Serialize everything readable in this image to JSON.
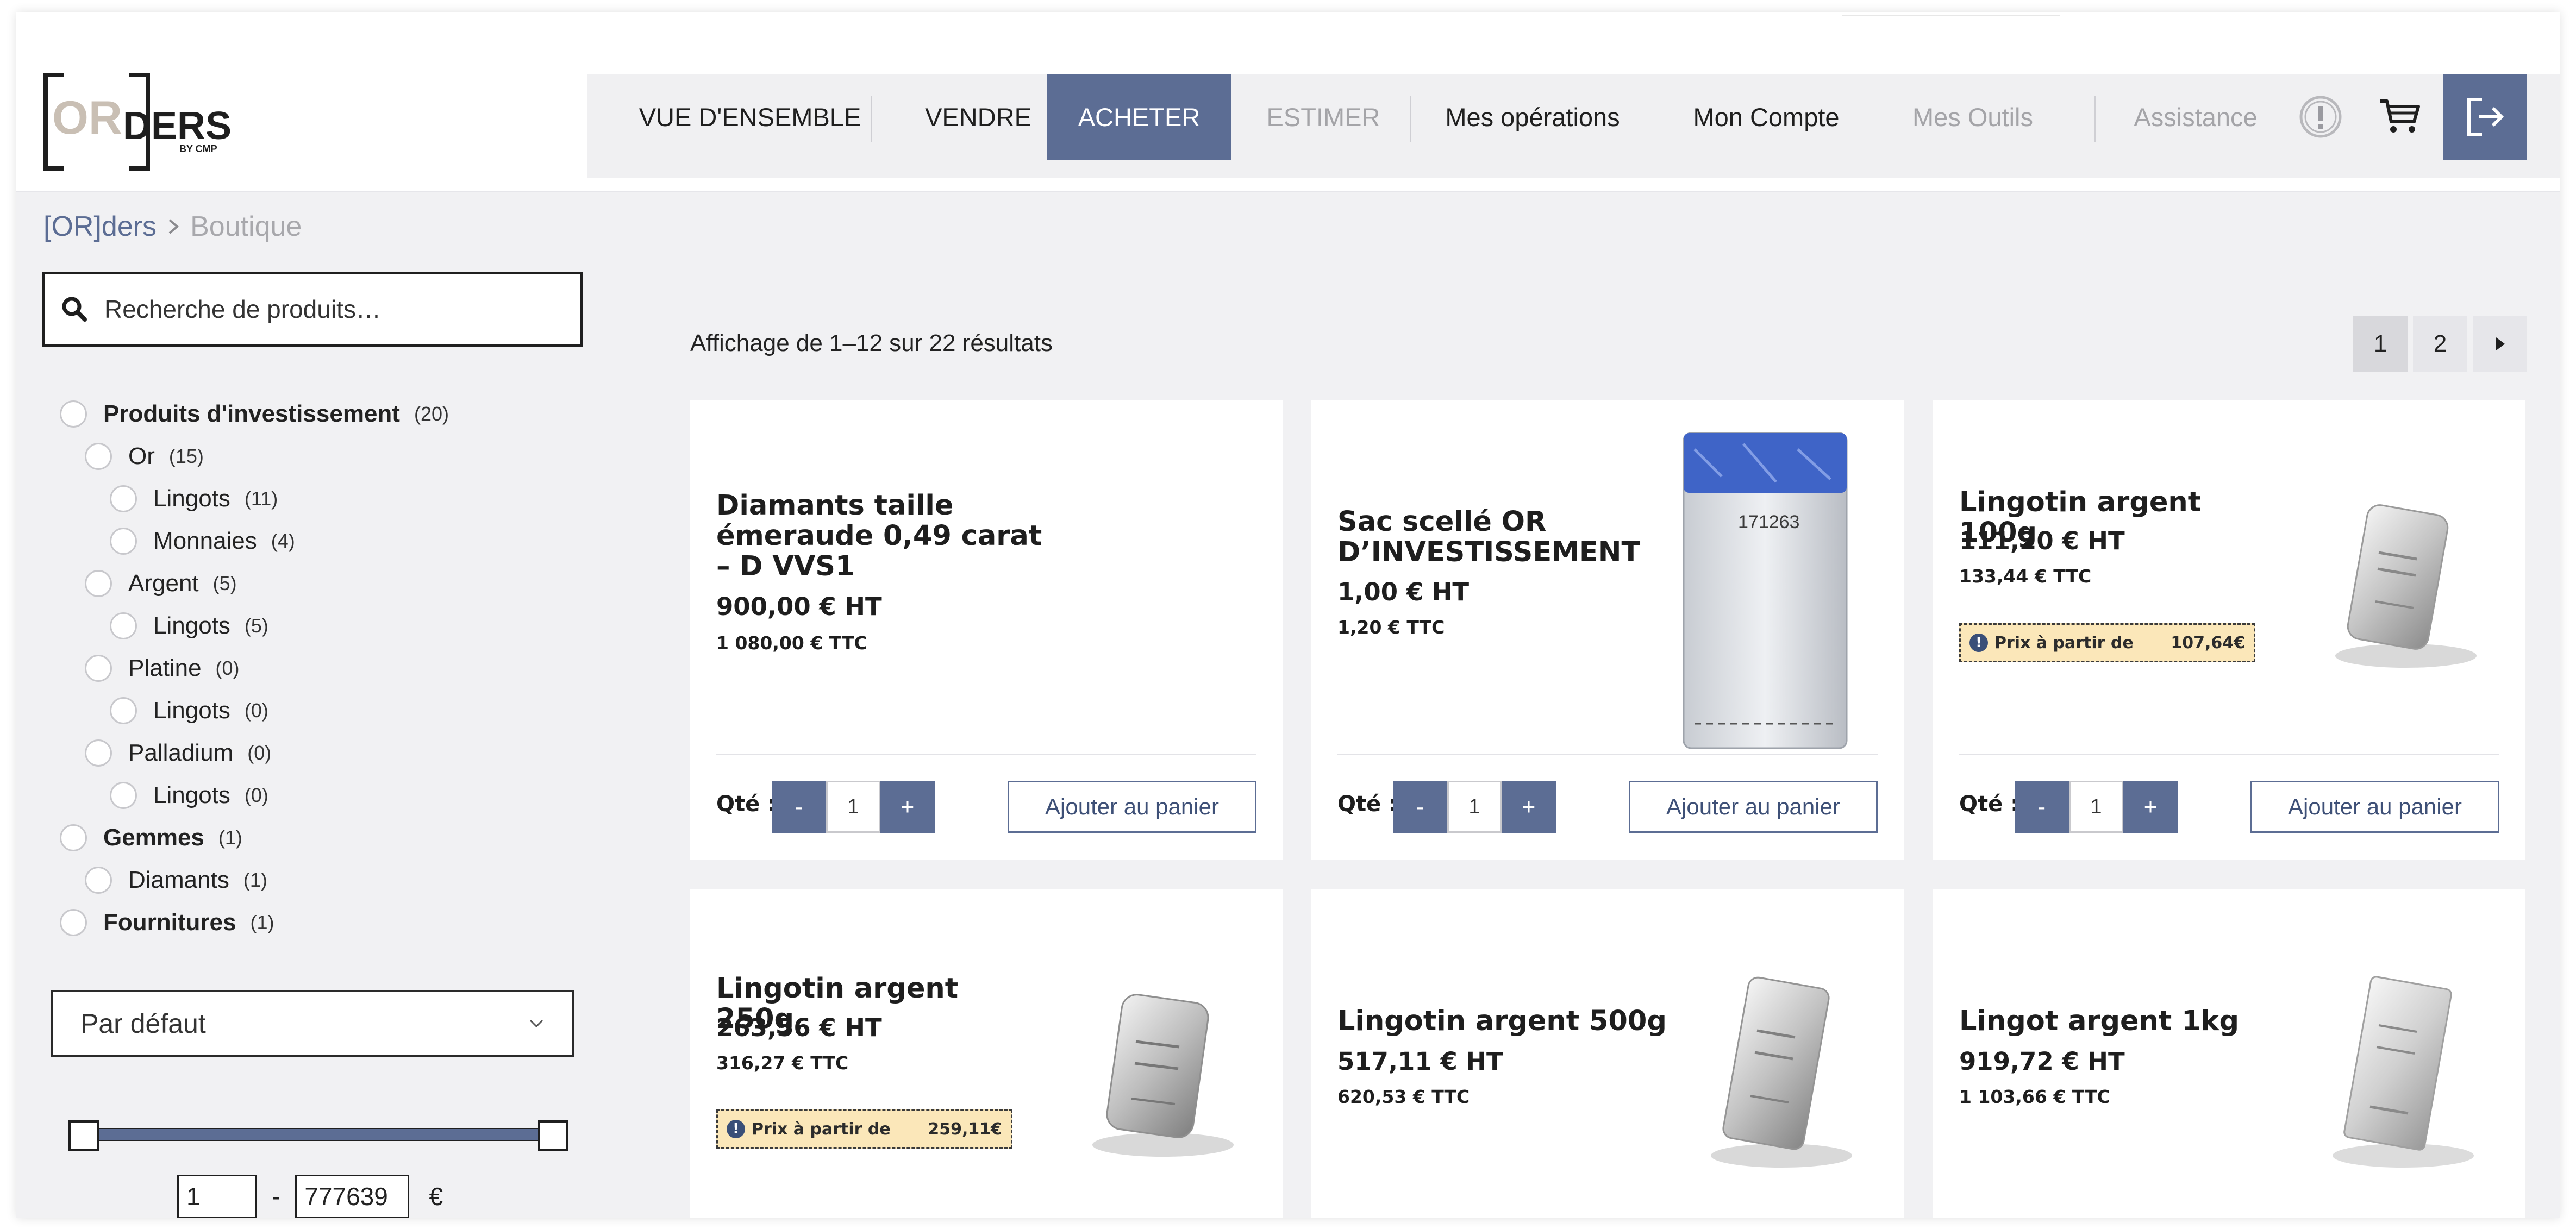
{
  "brand": {
    "logo_text_or": "OR",
    "logo_text_ders": "DERS",
    "logo_subtext": "BY CMP"
  },
  "nav": {
    "items": [
      {
        "label": "VUE D'ENSEMBLE",
        "state": "normal"
      },
      {
        "label": "VENDRE",
        "state": "normal"
      },
      {
        "label": "ACHETER",
        "state": "active"
      },
      {
        "label": "ESTIMER",
        "state": "disabled"
      },
      {
        "label": "Mes opérations",
        "state": "normal"
      },
      {
        "label": "Mon Compte",
        "state": "normal"
      },
      {
        "label": "Mes Outils",
        "state": "disabled"
      },
      {
        "label": "Assistance",
        "state": "disabled"
      }
    ],
    "icons": [
      "alert-circle-icon",
      "cart-icon",
      "logout-icon"
    ]
  },
  "breadcrumb": {
    "home": "[OR]ders",
    "current": "Boutique"
  },
  "search": {
    "placeholder": "Recherche de produits…"
  },
  "categories": [
    {
      "name": "Produits d'investissement",
      "count": "(20)"
    },
    {
      "name": "Or",
      "count": "(15)"
    },
    {
      "name": "Lingots",
      "count": "(11)"
    },
    {
      "name": "Monnaies",
      "count": "(4)"
    },
    {
      "name": "Argent",
      "count": "(5)"
    },
    {
      "name": "Lingots",
      "count": "(5)"
    },
    {
      "name": "Platine",
      "count": "(0)"
    },
    {
      "name": "Lingots",
      "count": "(0)"
    },
    {
      "name": "Palladium",
      "count": "(0)"
    },
    {
      "name": "Lingots",
      "count": "(0)"
    },
    {
      "name": "Gemmes",
      "count": "(1)"
    },
    {
      "name": "Diamants",
      "count": "(1)"
    },
    {
      "name": "Fournitures",
      "count": "(1)"
    }
  ],
  "sort": {
    "selected": "Par défaut"
  },
  "price_filter": {
    "min": "1",
    "max": "777639",
    "separator": "-",
    "currency": "€"
  },
  "results": {
    "count_text": "Affichage de 1–12 sur 22 résultats",
    "pages": [
      "1",
      "2"
    ],
    "current_page": "1"
  },
  "products": [
    {
      "title": "Diamants taille émeraude 0,49 carat – D VVS1",
      "price_ht": "900,00 € HT",
      "price_ttc": "1 080,00 € TTC",
      "image": "none"
    },
    {
      "title": "Sac scellé OR D’INVESTISSEMENT",
      "price_ht": "1,00 € HT",
      "price_ttc": "1,20 € TTC",
      "image": "sealed-bag",
      "image_code": "171263"
    },
    {
      "title": "Lingotin argent 100g",
      "price_ht": "111,20 € HT",
      "price_ttc": "133,44 € TTC",
      "badge_label": "Prix à partir de",
      "badge_value": "107,64€",
      "image": "silver-bar"
    },
    {
      "title": "Lingotin argent 250g",
      "price_ht": "263,56 € HT",
      "price_ttc": "316,27 € TTC",
      "badge_label": "Prix à partir de",
      "badge_value": "259,11€",
      "image": "silver-bar"
    },
    {
      "title": "Lingotin argent 500g",
      "price_ht": "517,11 € HT",
      "price_ttc": "620,53 € TTC",
      "image": "silver-bar"
    },
    {
      "title": "Lingot argent 1kg",
      "price_ht": "919,72 € HT",
      "price_ttc": "1 103,66 € TTC",
      "image": "silver-bar"
    }
  ],
  "card_controls": {
    "qty_label": "Qté :",
    "qty_value": "1",
    "minus": "-",
    "plus": "+",
    "add_to_cart": "Ajouter au panier"
  },
  "colors": {
    "accent": "#5c6d94",
    "background": "#f1f1f3",
    "badge_bg": "#fbe7b9",
    "muted": "#a4a4a8"
  }
}
